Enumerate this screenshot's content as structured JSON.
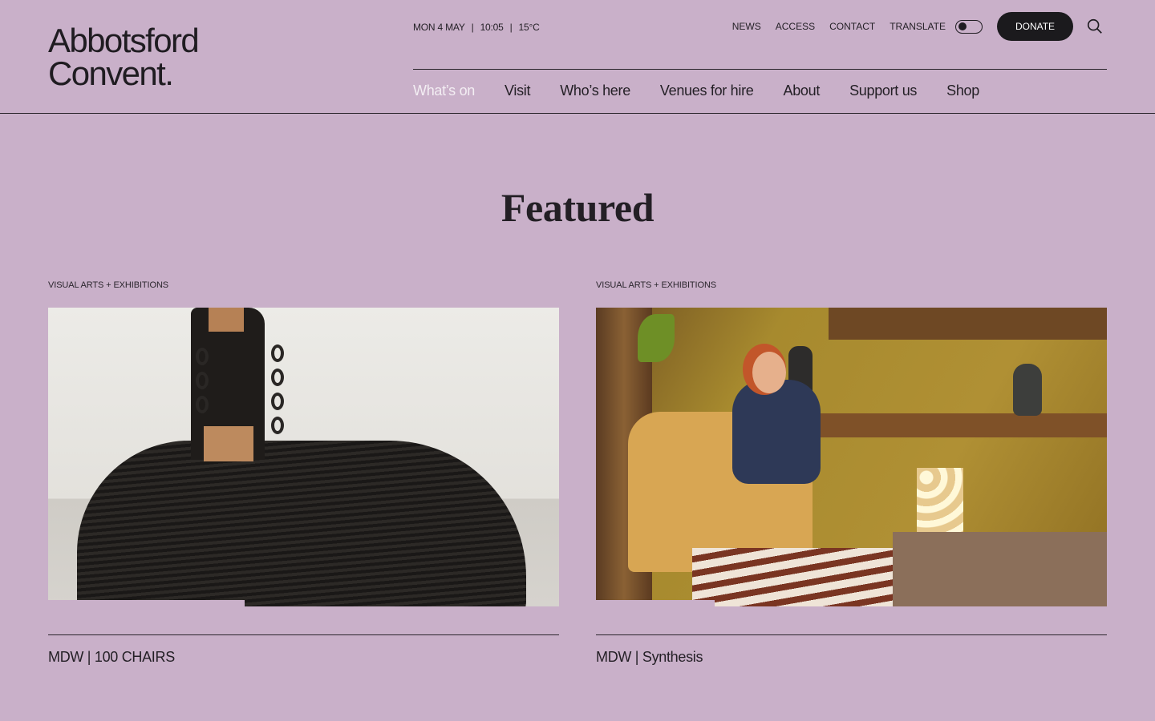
{
  "header": {
    "logo_line1": "Abbotsford",
    "logo_line2": "Convent.",
    "meta": {
      "date": "MON 4 MAY",
      "time": "10:05",
      "temp": "15°C",
      "separator": "|"
    },
    "utility": {
      "news": "NEWS",
      "access": "ACCESS",
      "contact": "CONTACT",
      "translate": "TRANSLATE",
      "donate": "DONATE"
    },
    "nav": [
      "What’s on",
      "Visit",
      "Who’s here",
      "Venues for hire",
      "About",
      "Support us",
      "Shop"
    ]
  },
  "main": {
    "title": "Featured",
    "cards": [
      {
        "category": "VISUAL ARTS + EXHIBITIONS",
        "caption": "MDW | 100 CHAIRS"
      },
      {
        "category": "VISUAL ARTS + EXHIBITIONS",
        "caption": "MDW | Synthesis"
      }
    ]
  },
  "colors": {
    "background": "#c9b0c9",
    "text": "#231f25",
    "donate_bg": "#1b1a1d",
    "active_nav": "#f3eef3"
  },
  "icons": {
    "search": "search-icon",
    "translate_toggle": "toggle-icon"
  }
}
